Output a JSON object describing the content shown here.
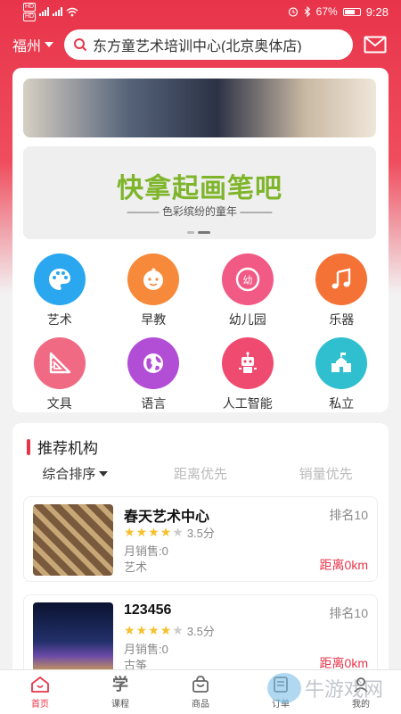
{
  "status_bar": {
    "badge_top": "HD",
    "badge_bottom": "HD",
    "battery": "67%",
    "time": "9:28"
  },
  "header": {
    "city": "福州",
    "search_value": "东方童艺术培训中心(北京奥体店)"
  },
  "banners": {
    "second_title": "快拿起画笔吧",
    "second_subtitle": "——— 色彩缤纷的童年 ———"
  },
  "categories": [
    {
      "label": "艺术",
      "icon": "palette-icon",
      "color": "#2aa7ee"
    },
    {
      "label": "早教",
      "icon": "baby-face-icon",
      "color": "#f68a3a"
    },
    {
      "label": "幼儿园",
      "icon": "kindergarten-badge-icon",
      "color": "#f25a86"
    },
    {
      "label": "乐器",
      "icon": "music-note-icon",
      "color": "#f57236"
    },
    {
      "label": "文具",
      "icon": "ruler-triangle-icon",
      "color": "#f06a84"
    },
    {
      "label": "语言",
      "icon": "globe-icon",
      "color": "#b24ed6"
    },
    {
      "label": "人工智能",
      "icon": "robot-icon",
      "color": "#ef4b70"
    },
    {
      "label": "私立",
      "icon": "school-icon",
      "color": "#2fbfcf"
    }
  ],
  "recommend": {
    "title": "推荐机构",
    "sort_options": [
      "综合排序",
      "距离优先",
      "销量优先"
    ],
    "orgs": [
      {
        "name": "春天艺术中心",
        "rank": "排名10",
        "score": "3.5分",
        "rating": 3.5,
        "sales": "月销售:0",
        "tag": "艺术",
        "distance": "距离0km"
      },
      {
        "name": "123456",
        "rank": "排名10",
        "score": "3.5分",
        "rating": 3.5,
        "sales": "月销售:0",
        "tag": "古筝",
        "distance": "距离0km"
      }
    ]
  },
  "bottom_nav": [
    {
      "label": "首页",
      "icon": "home-icon"
    },
    {
      "label": "课程",
      "icon": "study-icon",
      "glyph": "学"
    },
    {
      "label": "商品",
      "icon": "shopping-bag-icon"
    },
    {
      "label": "订单",
      "icon": "order-icon"
    },
    {
      "label": "我的",
      "icon": "profile-icon"
    }
  ],
  "watermark": "牛游戏网",
  "colors": {
    "accent": "#e8344a",
    "star": "#f6c02b"
  }
}
